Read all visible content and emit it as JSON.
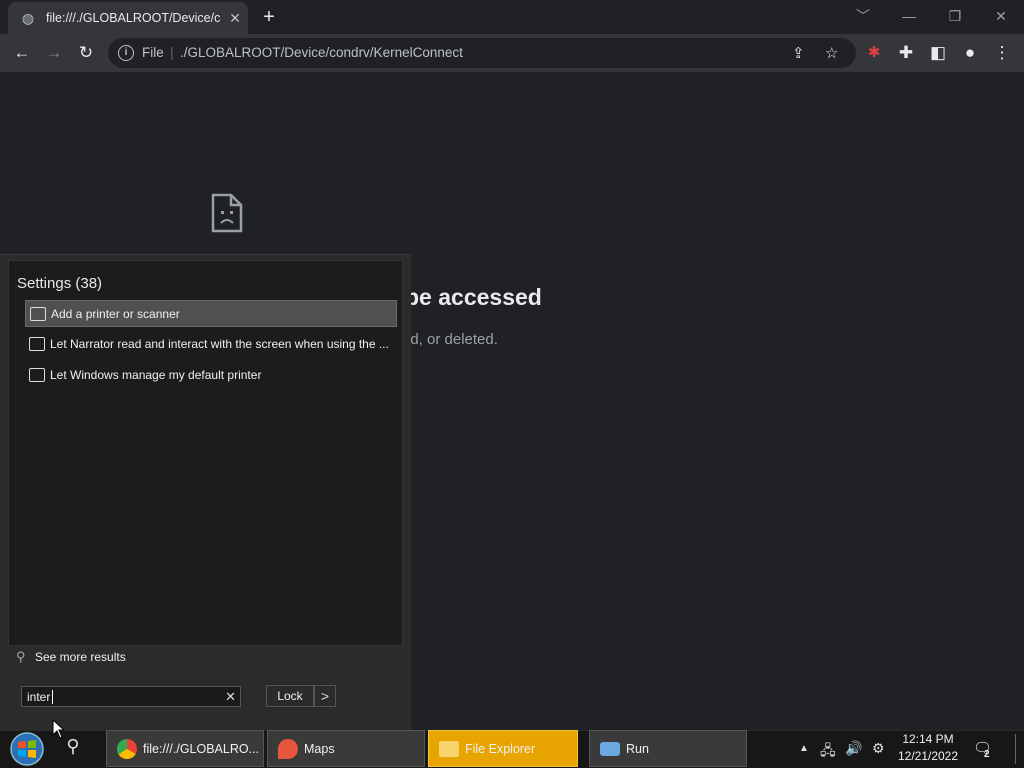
{
  "browser": {
    "tab_title": "file:///./GLOBALROOT/Device/con",
    "url_scheme": "File",
    "url_path": "./GLOBALROOT/Device/condrv/KernelConnect",
    "new_tab_symbol": "+",
    "window_controls": [
      "﹀",
      "—",
      "❐",
      "✕"
    ]
  },
  "page": {
    "error_title_fragment": "be accessed",
    "error_desc_fragment": "ed, or deleted."
  },
  "start_menu": {
    "results_header": "Settings (38)",
    "results": [
      {
        "label": "Add a printer or scanner",
        "icon": "printer-icon",
        "selected": true
      },
      {
        "label": "Let Narrator read and interact with the screen when using the ...",
        "icon": "narrator-icon",
        "selected": false
      },
      {
        "label": "Let Windows manage my default printer",
        "icon": "printer-icon",
        "selected": false
      }
    ],
    "see_more": "See more results",
    "search_value": "inter",
    "lock_label": "Lock",
    "lock_arrow": ">"
  },
  "taskbar": {
    "apps": [
      {
        "label": "file:///./GLOBALRO...",
        "icon": "chrome-icon",
        "color": "#3a3a3a"
      },
      {
        "label": "Maps",
        "icon": "maps-icon",
        "color": "#3a3a3a"
      },
      {
        "label": "File Explorer",
        "icon": "folder-icon",
        "color": "#e8a400"
      },
      {
        "label": "Run",
        "icon": "run-icon",
        "color": "#3a3a3a"
      }
    ],
    "clock_time": "12:14 PM",
    "clock_date": "12/21/2022",
    "notification_count": "2"
  },
  "colors": {
    "chrome_dark": "#202124",
    "toolbar": "#35363a",
    "active_task": "#e8a400"
  }
}
